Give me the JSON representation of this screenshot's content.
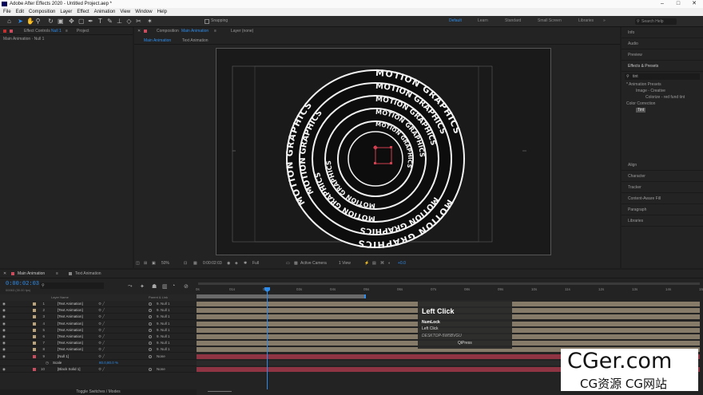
{
  "window": {
    "title": "Adobe After Effects 2020 - Untitled Project.aep *"
  },
  "menu": [
    "File",
    "Edit",
    "Composition",
    "Layer",
    "Effect",
    "Animation",
    "View",
    "Window",
    "Help"
  ],
  "toolbar": {
    "snapping_label": "Snapping",
    "workspaces": [
      "Default",
      "Learn",
      "Standard",
      "Small Screen",
      "Libraries"
    ],
    "active_workspace": "Default",
    "search_placeholder": "Search Help"
  },
  "left_panel": {
    "tab_effect_controls": "Effect Controls",
    "tab_effect_controls_target": "Null 1",
    "tab_project": "Project",
    "breadcrumb": "Main Animation · Null 1"
  },
  "comp_panel": {
    "tab_label": "Composition",
    "tab_comp_name": "Main Animation",
    "layer_tab": "Layer (none)",
    "subtabs": [
      "Main Animation",
      "Text Animation"
    ],
    "ring_text": "MOTION GRAPHICS",
    "viewer_controls": {
      "zoom": "50%",
      "timecode": "0:00:02:03",
      "resolution": "Full",
      "camera": "Active Camera",
      "views": "1 View",
      "exposure": "+0.0"
    }
  },
  "right_panel": {
    "items_top": [
      "Info",
      "Audio",
      "Preview"
    ],
    "effects_presets": "Effects & Presets",
    "search_value": "tint",
    "tree": [
      "* Animation Presets",
      "Image - Creative",
      "Colorize - red fund tint",
      "Color Correction",
      "Tint"
    ],
    "items_bottom": [
      "Align",
      "Character",
      "Tracker",
      "Content-Aware Fill",
      "Paragraph",
      "Libraries"
    ]
  },
  "timeline": {
    "tabs": [
      "Main Animation",
      "Text Animation"
    ],
    "timecode": "0:00:02:03",
    "timecode_sub": "00063 (30.00 fps)",
    "search_placeholder": "",
    "header": {
      "layer_name": "Layer Name",
      "parent": "Parent & Link"
    },
    "ruler_ticks": [
      "0s",
      "01s",
      "02s",
      "03s",
      "04s",
      "05s",
      "06s",
      "07s",
      "08s",
      "09s",
      "10s",
      "11s",
      "12s",
      "13s",
      "14s",
      "15s"
    ],
    "layers": [
      {
        "index": "1",
        "name": "[Text Animation]",
        "parent": "9. Null 1",
        "color": "#b9a27c"
      },
      {
        "index": "2",
        "name": "[Text Animation]",
        "parent": "9. Null 1",
        "color": "#b9a27c"
      },
      {
        "index": "3",
        "name": "[Text Animation]",
        "parent": "9. Null 1",
        "color": "#b9a27c"
      },
      {
        "index": "4",
        "name": "[Text Animation]",
        "parent": "9. Null 1",
        "color": "#b9a27c"
      },
      {
        "index": "5",
        "name": "[Text Animation]",
        "parent": "9. Null 1",
        "color": "#b9a27c"
      },
      {
        "index": "6",
        "name": "[Text Animation]",
        "parent": "9. Null 1",
        "color": "#b9a27c"
      },
      {
        "index": "7",
        "name": "[Text Animation]",
        "parent": "9. Null 1",
        "color": "#b9a27c"
      },
      {
        "index": "8",
        "name": "[Text Animation]",
        "parent": "9. Null 1",
        "color": "#b9a27c"
      },
      {
        "index": "9",
        "name": "[Null 1]",
        "parent": "None",
        "color": "#c94d5e"
      },
      {
        "index": "",
        "name": "Scale",
        "value": "80.0,80.0 %",
        "parent": "",
        "color": ""
      },
      {
        "index": "10",
        "name": "[Black Solid 1]",
        "parent": "None",
        "color": "#c94d5e"
      }
    ],
    "bottom_label": "Toggle Switches / Modes"
  },
  "tooltip": {
    "title": "Left Click",
    "line1": "NumLock",
    "line2": "Left Click",
    "line3": "DESKTOP-5W5BVGU",
    "line4": "QiPress"
  },
  "watermark": {
    "line1": "CGer.com",
    "line2": "CG资源 CG网站"
  }
}
